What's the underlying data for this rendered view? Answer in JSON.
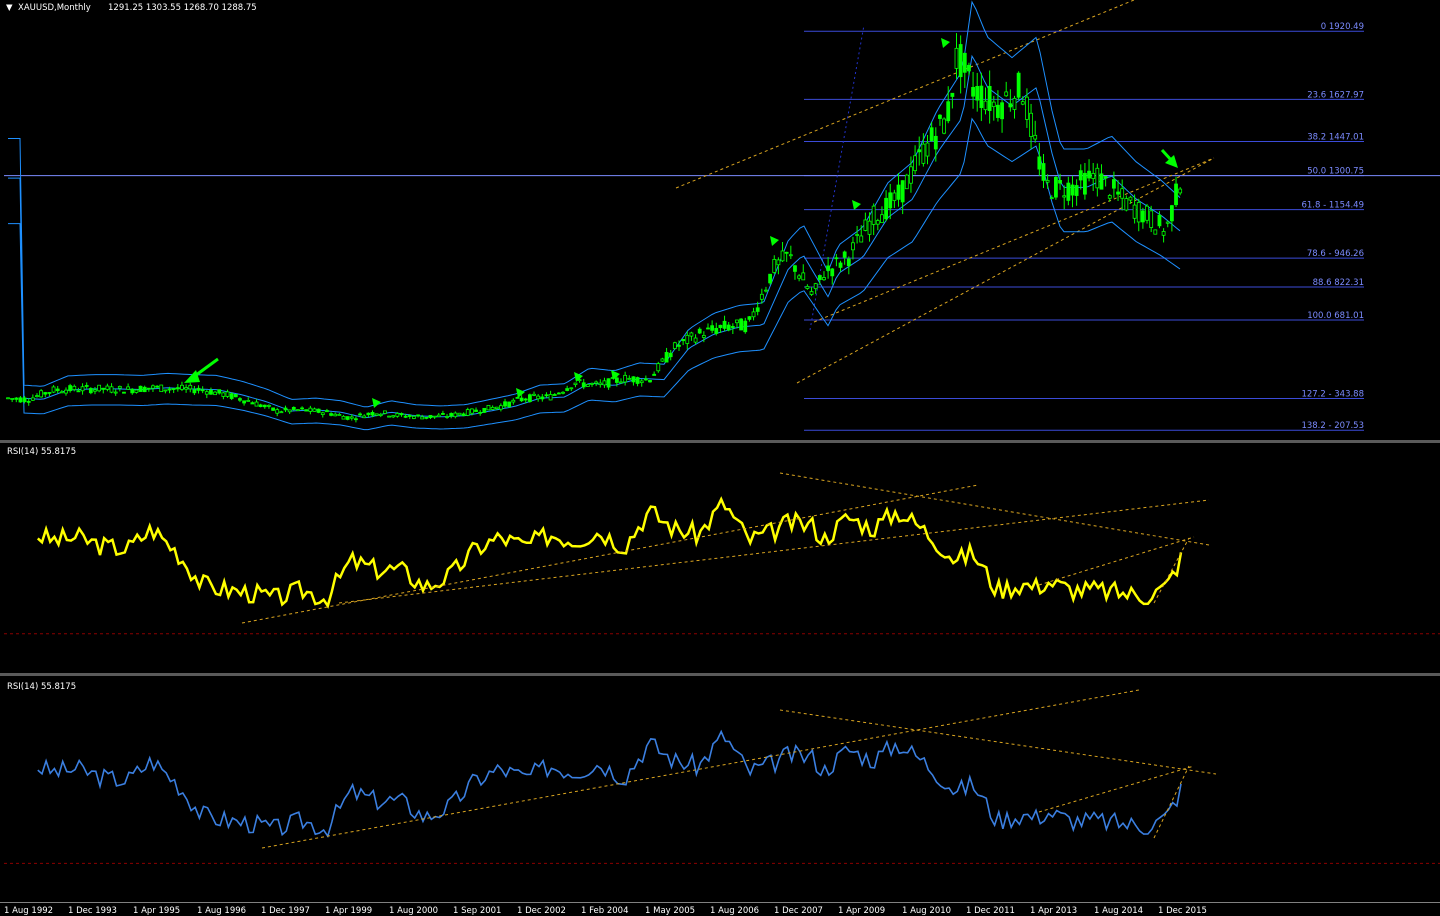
{
  "header": {
    "symbol_timeframe": "XAUUSD,Monthly",
    "ohlc": "1291.25 1303.55 1268.70 1288.75"
  },
  "colors": {
    "candle": "#00ff00",
    "bands": "#1e90ff",
    "fib": "#3b4bd8",
    "trend": "#daa520",
    "rsi_yellow": "#ffff00",
    "rsi_blue": "#3b7fe0",
    "rsi_level": "#8b0000",
    "arrow": "#00ff00"
  },
  "chart_data": [
    {
      "type": "line",
      "title": "XAUUSD,Monthly",
      "x_tick_labels": [
        "1 Aug 1992",
        "1 Dec 1993",
        "1 Apr 1995",
        "1 Aug 1996",
        "1 Dec 1997",
        "1 Apr 1999",
        "1 Aug 2000",
        "1 Sep 2001",
        "1 Dec 2002",
        "1 Feb 2004",
        "1 May 2005",
        "1 Aug 2006",
        "1 Dec 2007",
        "1 Apr 2009",
        "1 Aug 2010",
        "1 Dec 2011",
        "1 Apr 2013",
        "1 Aug 2014",
        "1 Dec 2015"
      ],
      "x": [
        1992.6,
        1993.0,
        1993.5,
        1994.0,
        1994.5,
        1995.0,
        1995.5,
        1996.0,
        1996.5,
        1997.0,
        1997.5,
        1998.0,
        1998.5,
        1999.0,
        1999.5,
        2000.0,
        2000.5,
        2001.0,
        2001.5,
        2002.0,
        2002.5,
        2003.0,
        2003.5,
        2004.0,
        2004.5,
        2005.0,
        2005.5,
        2006.0,
        2006.5,
        2007.0,
        2007.5,
        2008.0,
        2008.3,
        2008.8,
        2009.0,
        2009.5,
        2010.0,
        2010.5,
        2011.0,
        2011.5,
        2011.7,
        2012.0,
        2012.5,
        2013.0,
        2013.3,
        2013.5,
        2014.0,
        2014.5,
        2015.0,
        2015.5,
        2015.9,
        2016.2
      ],
      "series": [
        {
          "values": [
            345,
            340,
            380,
            385,
            385,
            382,
            390,
            385,
            382,
            360,
            330,
            290,
            295,
            285,
            260,
            285,
            270,
            265,
            270,
            290,
            310,
            345,
            350,
            410,
            400,
            430,
            425,
            560,
            620,
            650,
            660,
            900,
            960,
            780,
            880,
            950,
            1120,
            1200,
            1400,
            1550,
            1820,
            1680,
            1600,
            1680,
            1400,
            1250,
            1250,
            1300,
            1200,
            1130,
            1060,
            1290
          ]
        }
      ],
      "fib_levels": [
        {
          "label": "0 1920.49",
          "value": 1920.49
        },
        {
          "label": "23.6 1627.97",
          "value": 1627.97
        },
        {
          "label": "38.2 1447.01",
          "value": 1447.01
        },
        {
          "label": "50.0 1300.75",
          "value": 1300.75
        },
        {
          "label": "61.8 - 1154.49",
          "value": 1154.49
        },
        {
          "label": "78.6 - 946.26",
          "value": 946.26
        },
        {
          "label": "88.6 822.31",
          "value": 822.31
        },
        {
          "label": "100.0 681.01",
          "value": 681.01
        },
        {
          "label": "127.2 - 343.88",
          "value": 343.88
        },
        {
          "label": "138.2 - 207.53",
          "value": 207.53
        }
      ],
      "ylim": [
        200,
        1960
      ]
    },
    {
      "type": "line",
      "title": "RSI(14) 55.8175",
      "series": [
        {
          "values": [
            63,
            65,
            62,
            63,
            60,
            59,
            66,
            58,
            47,
            45,
            44,
            42,
            45,
            42,
            55,
            52,
            52,
            46,
            50,
            59,
            63,
            60,
            64,
            62,
            65,
            60,
            72,
            66,
            64,
            75,
            62,
            65,
            68,
            67,
            62,
            70,
            66,
            72,
            66,
            58,
            55,
            58,
            45,
            47,
            46,
            48,
            45,
            45,
            44,
            43,
            46,
            55.8
          ]
        }
      ],
      "level": 30,
      "ylim": [
        20,
        85
      ]
    },
    {
      "type": "line",
      "title": "RSI(14) 55.8175",
      "series": [
        {
          "values": [
            63,
            65,
            62,
            63,
            60,
            59,
            66,
            58,
            47,
            45,
            44,
            42,
            45,
            42,
            55,
            52,
            52,
            46,
            50,
            59,
            63,
            60,
            64,
            62,
            65,
            60,
            72,
            66,
            64,
            75,
            62,
            65,
            68,
            67,
            62,
            70,
            66,
            72,
            66,
            58,
            55,
            58,
            45,
            47,
            46,
            48,
            45,
            45,
            44,
            43,
            46,
            55.8
          ]
        }
      ],
      "level": 30,
      "ylim": [
        20,
        85
      ]
    }
  ],
  "rsi_panes": [
    {
      "label": "RSI(14) 55.8175"
    },
    {
      "label": "RSI(14) 55.8175"
    }
  ]
}
